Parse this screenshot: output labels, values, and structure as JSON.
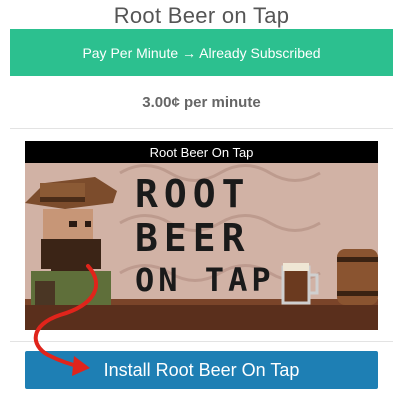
{
  "page": {
    "title": "Root Beer on Tap"
  },
  "banner": {
    "label": "Pay Per Minute → Already Subscribed",
    "color": "#2cc08f"
  },
  "pricing": {
    "price_text": "3.00¢ per minute"
  },
  "game": {
    "card_title": "Root Beer On Tap",
    "art_logo_lines": [
      "ROOT",
      "BEER",
      "ON TAP"
    ]
  },
  "install": {
    "label": "Install Root Beer On Tap",
    "color": "#1e7fb4"
  },
  "annotation": {
    "arrow_color": "#e0241b",
    "icon": "curved-arrow-icon"
  }
}
